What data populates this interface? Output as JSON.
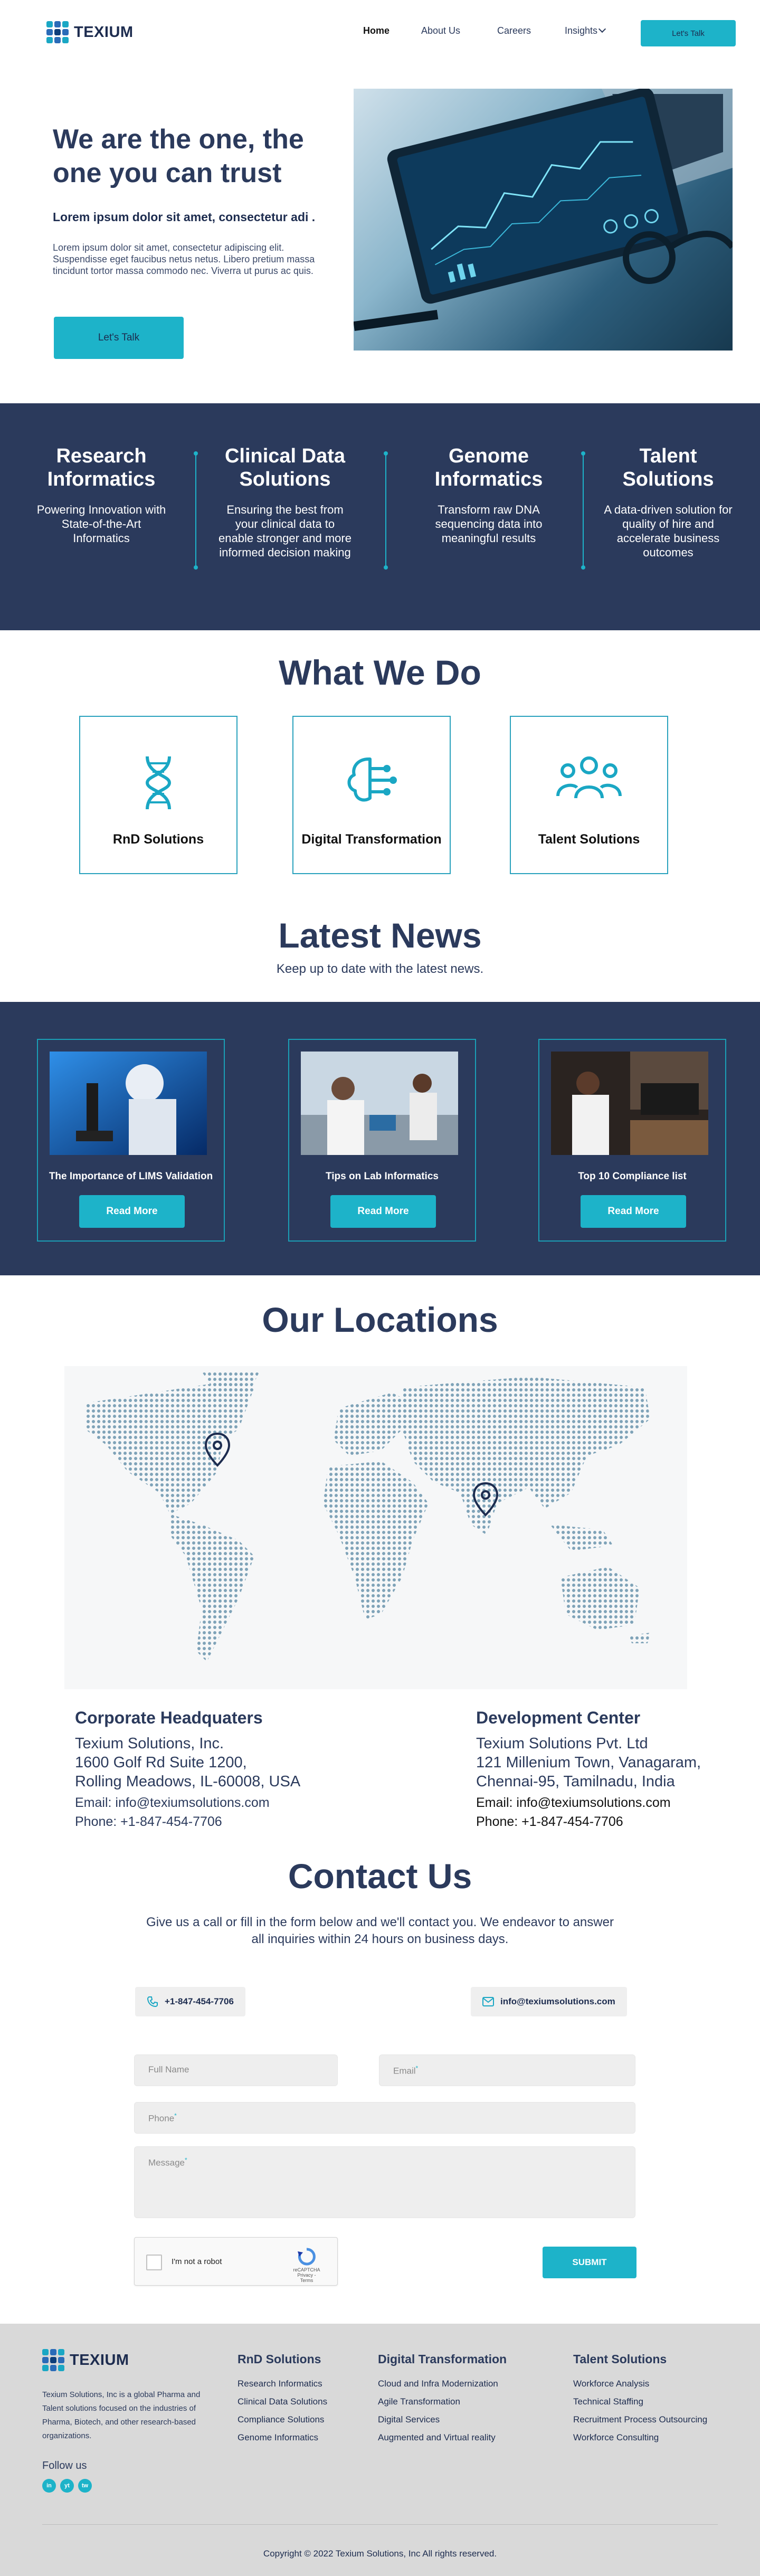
{
  "brand": {
    "name": "TEXIUM"
  },
  "nav": {
    "links": [
      "Home",
      "About Us",
      "Careers",
      "Insights"
    ],
    "cta": "Let's Talk"
  },
  "hero": {
    "title": "We are the one, the one you can trust",
    "subtitle": "Lorem ipsum dolor sit amet, consectetur adi .",
    "body": "Lorem ipsum dolor sit amet, consectetur adipiscing elit. Suspendisse eget faucibus netus netus. Libero pretium massa tincidunt tortor massa commodo nec. Viverra ut purus ac quis.",
    "cta": "Let's Talk"
  },
  "services": [
    {
      "title": "Research Informatics",
      "desc": "Powering Innovation with State-of-the-Art Informatics"
    },
    {
      "title": "Clinical Data Solutions",
      "desc": "Ensuring  the best from your clinical data to enable stronger and more informed decision making"
    },
    {
      "title": "Genome Informatics",
      "desc": "Transform raw DNA sequencing data into meaningful results"
    },
    {
      "title": "Talent Solutions",
      "desc": "A data-driven solution for quality of hire and accelerate business outcomes"
    }
  ],
  "what_we_do": {
    "title": "What We Do",
    "items": [
      {
        "label": "RnD Solutions",
        "icon": "dna-icon"
      },
      {
        "label": "Digital Transformation",
        "icon": "brain-circuit-icon"
      },
      {
        "label": "Talent Solutions",
        "icon": "people-group-icon"
      }
    ]
  },
  "news": {
    "title": "Latest News",
    "subtitle": "Keep up to date with the latest news.",
    "items": [
      {
        "title": "The Importance of LIMS Validation",
        "cta": "Read More"
      },
      {
        "title": "Tips on Lab Informatics",
        "cta": "Read More"
      },
      {
        "title": "Top 10 Compliance list",
        "cta": "Read More"
      }
    ]
  },
  "locations": {
    "title": "Our Locations",
    "corporate": {
      "heading": "Corporate Headquaters",
      "lines": [
        "Texium Solutions, Inc.",
        "1600 Golf Rd Suite 1200,",
        "Rolling Meadows, IL-60008, USA"
      ],
      "email": "Email: info@texiumsolutions.com",
      "phone": "Phone: +1-847-454-7706"
    },
    "development": {
      "heading": "Development Center",
      "lines": [
        "Texium Solutions Pvt. Ltd",
        "121 Millenium Town, Vanagaram,",
        "Chennai-95, Tamilnadu, India"
      ],
      "email": "Email: info@texiumsolutions.com",
      "phone": "Phone: +1-847-454-7706"
    }
  },
  "contact": {
    "title": "Contact Us",
    "intro": "Give us a call or fill in the form below and we'll contact you. We endeavor to answer all inquiries within 24 hours on business days.",
    "phone": "+1-847-454-7706",
    "email": "info@texiumsolutions.com",
    "form": {
      "full_name_placeholder": "Full Name",
      "email_placeholder": "Email",
      "phone_placeholder": "Phone",
      "message_placeholder": "Message",
      "required_mark": "*",
      "captcha_label": "I'm not a robot",
      "captcha_brand": "reCAPTCHA",
      "captcha_links": "Privacy - Terms",
      "submit": "SUBMIT"
    }
  },
  "footer": {
    "description": "Texium Solutions, Inc is a global Pharma and Talent solutions focused on the industries of Pharma, Biotech, and other research-based organizations.",
    "follow": "Follow us",
    "socials": [
      "in",
      "yt",
      "tw"
    ],
    "columns": [
      {
        "title": "RnD Solutions",
        "items": [
          "Research Informatics",
          "Clinical Data Solutions",
          "Compliance Solutions",
          "Genome Informatics"
        ]
      },
      {
        "title": "Digital Transformation",
        "items": [
          "Cloud and Infra Modernization",
          "Agile Transformation",
          "Digital Services",
          "Augmented and Virtual reality"
        ]
      },
      {
        "title": "Talent Solutions",
        "items": [
          "Workforce Analysis",
          "Technical Staffing",
          "Recruitment Process Outsourcing",
          "Workforce Consulting"
        ]
      }
    ],
    "copyright": "Copyright © 2022 Texium Solutions, Inc All rights reserved."
  },
  "colors": {
    "navy": "#2b3a5c",
    "teal": "#1db3c9",
    "footer_bg": "#d9d9d9"
  }
}
